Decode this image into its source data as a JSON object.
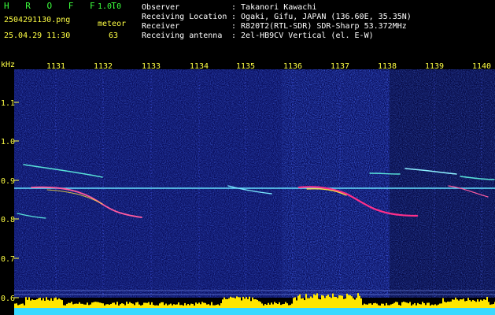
{
  "app": {
    "name": "H R O F F T",
    "version": "1.0.0",
    "file": "2504291130.png",
    "datetime": "25.04.29 11:30",
    "mode_label": "meteor",
    "count": "63"
  },
  "info": {
    "rows": [
      {
        "label": "Observer",
        "value": ": Takanori Kawachi"
      },
      {
        "label": "Receiving Location",
        "value": ": Ogaki, Gifu, JAPAN (136.60E, 35.35N)"
      },
      {
        "label": "Receiver",
        "value": ": R820T2(RTL-SDR) SDR-Sharp 53.372MHz"
      },
      {
        "label": "Receiving antenna",
        "value": ": 2el-HB9CV Vertical (el. E-W)"
      }
    ]
  },
  "axes": {
    "y_unit": "kHz",
    "y_ticks": [
      "1.1",
      "1.0",
      "0.9",
      "0.8",
      "0.7",
      "0.6"
    ],
    "x_ticks": [
      "1131",
      "1132",
      "1133",
      "1134",
      "1135",
      "1136",
      "1137",
      "1138",
      "1139",
      "1140"
    ]
  },
  "colors": {
    "background": "#000000",
    "noise_blue": "#1a2aa8",
    "header_green": "#3cff3c",
    "tick_yellow": "#ffff44",
    "baseline_cyan": "#39d9ff"
  }
}
